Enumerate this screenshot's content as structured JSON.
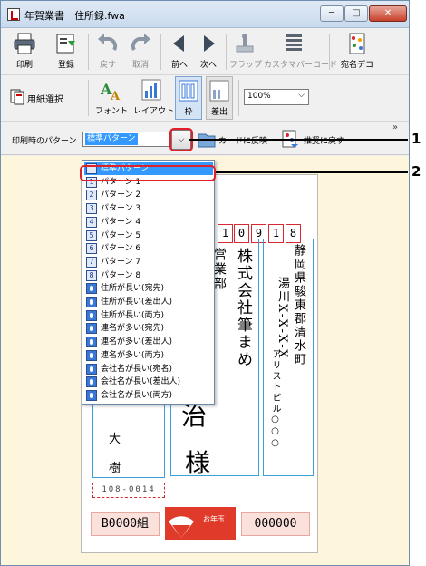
{
  "window": {
    "title": "年賀業書　住所録.fwa",
    "min_glyph": "─",
    "max_glyph": "□",
    "close_glyph": "✕"
  },
  "toolbar1": [
    {
      "label": "印刷",
      "icon": "printer-icon"
    },
    {
      "label": "登録",
      "icon": "register-icon"
    },
    {
      "label": "戻す",
      "icon": "undo-icon",
      "disabled": true
    },
    {
      "label": "取消",
      "icon": "redo-icon",
      "disabled": true
    },
    {
      "label": "前へ",
      "icon": "prev-icon"
    },
    {
      "label": "次へ",
      "icon": "next-icon"
    },
    {
      "label": "フラップ",
      "icon": "flap-icon",
      "disabled": true
    },
    {
      "label": "カスタマバーコード",
      "icon": "barcode-icon",
      "disabled": true
    },
    {
      "label": "宛名デコ",
      "icon": "deco-icon"
    }
  ],
  "toolbar2": {
    "paper_select_label": "用紙選択",
    "font_label": "フォント",
    "layout_label": "レイアウト",
    "frame_label": "枠",
    "sender_label": "差出",
    "zoom_value": "100%"
  },
  "toolbar3": {
    "pattern_label": "印刷時のパターン",
    "pattern_value": "標準パターン",
    "dropdown_arrow": "⌵",
    "apply_card_label": "カードに反映",
    "recommend_label": "推奨に戻す",
    "overflow_glyph": "»"
  },
  "dropdown_items": [
    {
      "label": "標準パターン",
      "kind": "std",
      "selected": true
    },
    {
      "label": "パターン 1",
      "kind": "num",
      "n": "1"
    },
    {
      "label": "パターン 2",
      "kind": "num",
      "n": "2"
    },
    {
      "label": "パターン 3",
      "kind": "num",
      "n": "3"
    },
    {
      "label": "パターン 4",
      "kind": "num",
      "n": "4"
    },
    {
      "label": "パターン 5",
      "kind": "num",
      "n": "5"
    },
    {
      "label": "パターン 6",
      "kind": "num",
      "n": "6"
    },
    {
      "label": "パターン 7",
      "kind": "num",
      "n": "7"
    },
    {
      "label": "パターン 8",
      "kind": "num",
      "n": "8"
    },
    {
      "label": "住所が長い(宛先)",
      "kind": "pin"
    },
    {
      "label": "住所が長い(差出人)",
      "kind": "pin"
    },
    {
      "label": "住所が長い(両方)",
      "kind": "pin"
    },
    {
      "label": "連名が多い(宛先)",
      "kind": "pin"
    },
    {
      "label": "連名が多い(差出人)",
      "kind": "pin"
    },
    {
      "label": "連名が多い(両方)",
      "kind": "pin"
    },
    {
      "label": "会社名が長い(宛名)",
      "kind": "pin"
    },
    {
      "label": "会社名が長い(差出人)",
      "kind": "pin"
    },
    {
      "label": "会社名が長い(両方)",
      "kind": "pin"
    }
  ],
  "card": {
    "zip_digits": [
      "1",
      "0",
      "9",
      "1",
      "8"
    ],
    "address_line1": "静岡県駿東郡清水町",
    "address_line2": "湯川X-X-X-X",
    "building": "アリストビル○○○",
    "company": "株式会社筆まめ",
    "department": "営業部",
    "name_fragment": "治",
    "honorific": "様",
    "sender_name1": "大",
    "sender_name2": "樹",
    "sender_zip": "108-0014",
    "lottery_left": "B0000組",
    "lottery_right": "000000",
    "stamp_text": "お年玉"
  },
  "callouts": {
    "one": "1",
    "two": "2"
  }
}
